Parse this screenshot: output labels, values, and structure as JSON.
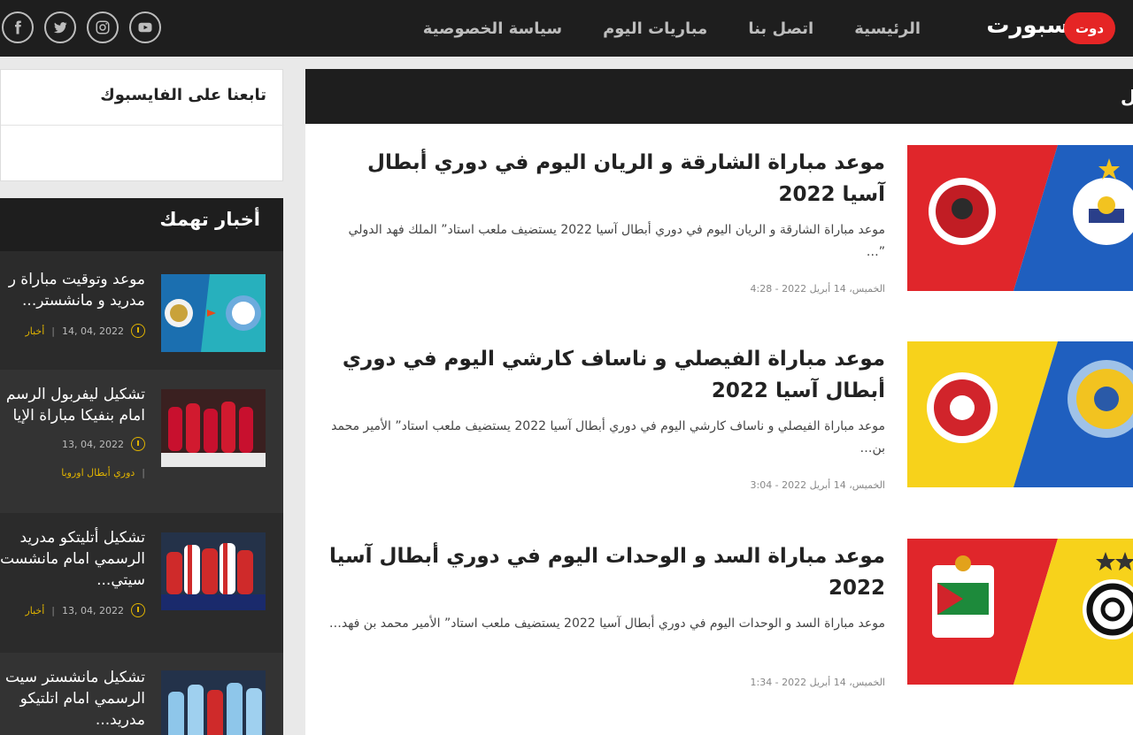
{
  "header": {
    "logo_word": "سبورت",
    "logo_badge": "دوت",
    "nav": [
      "الرئيسية",
      "اتصل بنا",
      "مباريات اليوم",
      "سياسة الخصوصية"
    ],
    "socials": [
      "youtube-icon",
      "instagram-icon",
      "twitter-icon",
      "facebook-icon"
    ]
  },
  "main": {
    "section_title": "ل",
    "articles": [
      {
        "title": "موعد مباراة الشارقة و الريان اليوم في دوري أبطال آسيا 2022",
        "excerpt": "موعد مباراة الشارقة و الريان اليوم في دوري أبطال آسيا 2022 يستضيف ملعب استاد” الملك فهد الدولي ”…",
        "date": "الخميس، 14 أبريل 2022 - 4:28",
        "colors": [
          "#e0262b",
          "#1f5fbf"
        ]
      },
      {
        "title": "موعد مباراة الفيصلي و ناساف كارشي اليوم في دوري أبطال آسيا 2022",
        "excerpt": "موعد مباراة الفيصلي و ناساف كارشي اليوم في دوري أبطال آسيا 2022 يستضيف ملعب استاد” الأمير محمد بن…",
        "date": "الخميس، 14 أبريل 2022 - 3:04",
        "colors": [
          "#f7d21b",
          "#1f5fbf"
        ]
      },
      {
        "title": "موعد مباراة السد و الوحدات اليوم في دوري أبطال آسيا 2022",
        "excerpt": "موعد مباراة السد و الوحدات اليوم في دوري أبطال آسيا 2022 يستضيف ملعب استاد” الأمير محمد بن فهد…",
        "date": "الخميس، 14 أبريل 2022 - 1:34",
        "colors": [
          "#e0262b",
          "#f7d21b"
        ]
      }
    ]
  },
  "sidebar": {
    "facebook_title": "تابعنا على الفايسبوك",
    "news_title": "أخبار تهمك",
    "items": [
      {
        "line1": "موعد وتوقيت مباراة ر",
        "line2": "مدريد و مانشستر...",
        "date": "2022 ,04 ,14",
        "category": "أخبار"
      },
      {
        "line1": "تشكيل ليفربول الرسم",
        "line2": "امام بنفيكا مباراة الإيا",
        "date": "2022 ,04 ,13",
        "category": "دوري أبطال اوروبا"
      },
      {
        "line1": "تشكيل أتليتكو مدريد",
        "line2": "الرسمي امام مانشست",
        "line3": "سيتي...",
        "date": "2022 ,04 ,13",
        "category": "أخبار"
      },
      {
        "line1": "تشكيل مانشستر سيت",
        "line2": "الرسمي امام اتلتيكو",
        "line3": "مدريد..."
      }
    ]
  }
}
